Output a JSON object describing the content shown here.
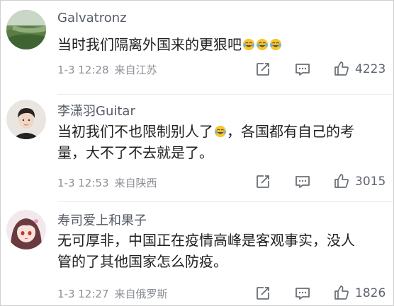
{
  "comments": [
    {
      "username": "Galvatronz",
      "text": "当时我们隔离外国来的更狠吧",
      "emoji_count": 3,
      "date_time": "1-3 12:28",
      "location": "来自江苏",
      "likes": "4223",
      "avatar_icon": "landscape-avatar"
    },
    {
      "username": "李潇羽Guitar",
      "text_line1_a": "当初我们不也限制别人了",
      "text_line1_b": "，各国都有自己的考",
      "text_line2": "量，大不了不去就是了。",
      "date_time": "1-3 12:53",
      "location": "来自陕西",
      "likes": "3015",
      "avatar_icon": "person-avatar"
    },
    {
      "username": "寿司爱上和果子",
      "text_line1": "无可厚非，中国正在疫情高峰是客观事实，没人",
      "text_line2": "管的了其他国家怎么防疫。",
      "date_time": "1-3 12:27",
      "location": "来自俄罗斯",
      "likes": "1826",
      "avatar_icon": "anime-girl-avatar"
    }
  ],
  "icons": {
    "share": "share-icon",
    "reply": "comment-icon",
    "like": "thumbs-up-icon",
    "emoji": "laughing-tears-emoji"
  },
  "colors": {
    "username": "#555b66",
    "meta": "#8b8f96",
    "text": "#1f1f1f"
  }
}
